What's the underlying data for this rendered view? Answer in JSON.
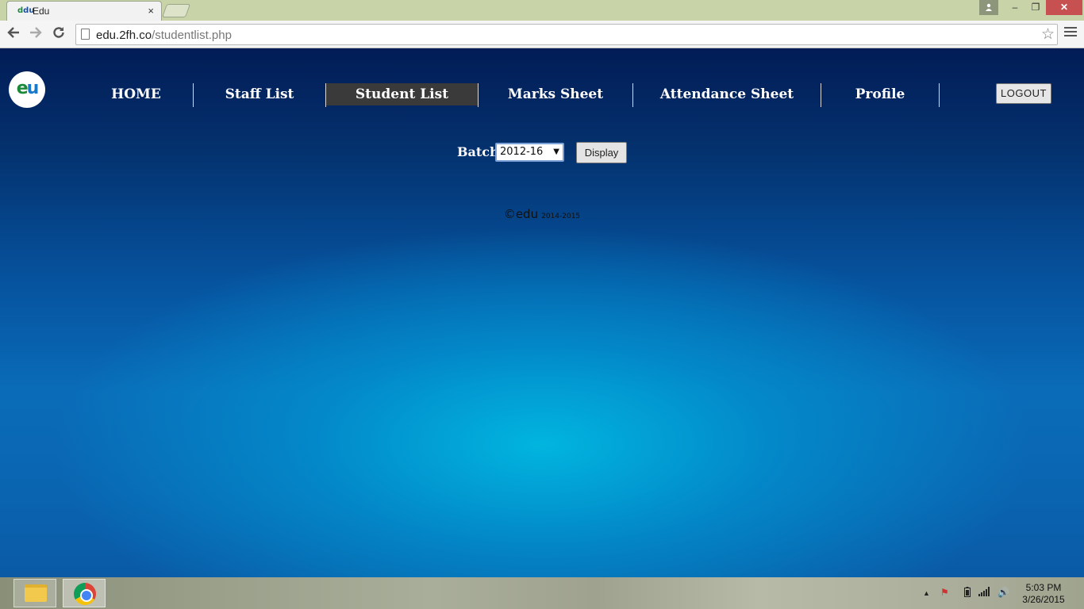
{
  "browser": {
    "tab_title": "Edu",
    "favicon_text": "du",
    "tab_close": "×",
    "url_host": "edu.2fh.co",
    "url_path": "/studentlist.php",
    "user_icon": "person-icon",
    "minimize": "–",
    "maximize": "❐",
    "close": "✕"
  },
  "site": {
    "logo_e": "e",
    "logo_u": "u",
    "nav": [
      {
        "label": "HOME",
        "active": false
      },
      {
        "label": "Staff List",
        "active": false
      },
      {
        "label": "Student List",
        "active": true
      },
      {
        "label": "Marks Sheet",
        "active": false
      },
      {
        "label": "Attendance Sheet",
        "active": false
      },
      {
        "label": "Profile",
        "active": false
      }
    ],
    "logout_label": "LOGOUT",
    "batch_label": "Batch",
    "batch_selected": "2012-16",
    "display_label": "Display",
    "footer_brand": "©edu",
    "footer_years": "2014-2015"
  },
  "taskbar": {
    "time": "5:03 PM",
    "date": "3/26/2015"
  },
  "colors": {
    "nav_active_bg": "#3a3a3a",
    "close_button": "#c75050"
  }
}
